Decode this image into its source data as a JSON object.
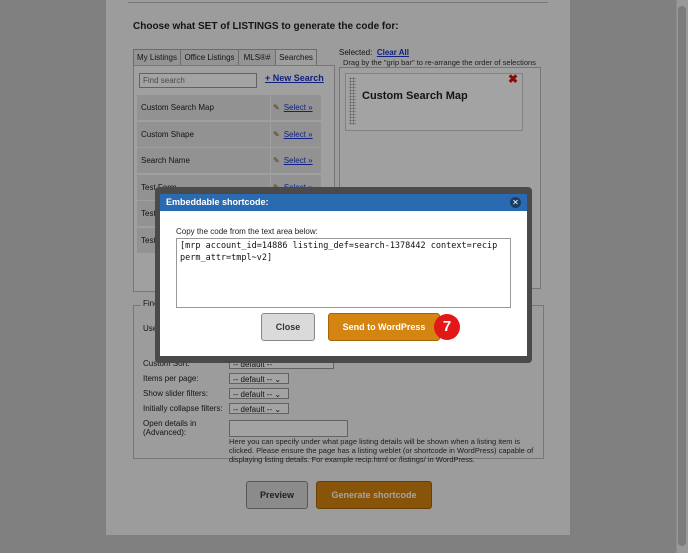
{
  "heading": "Choose what SET of LISTINGS to generate the code for:",
  "tabs": [
    {
      "label": "My Listings",
      "active": false
    },
    {
      "label": "Office Listings",
      "active": false
    },
    {
      "label": "MLS®#",
      "active": false
    },
    {
      "label": "Searches",
      "active": true
    }
  ],
  "search": {
    "placeholder": "Find search",
    "new_search_label": "+ New Search"
  },
  "searches": [
    {
      "name": "Custom Search Map",
      "select_label": "Select »"
    },
    {
      "name": "Custom Shape",
      "select_label": "Select »"
    },
    {
      "name": "Search Name",
      "select_label": "Select »"
    },
    {
      "name": "Test Form",
      "select_label": "Select »"
    },
    {
      "name": "Test S",
      "select_label": ""
    },
    {
      "name": "Test S",
      "select_label": ""
    }
  ],
  "selected": {
    "label": "Selected:",
    "clear_all": "Clear All",
    "hint": "Drag by the \"grip bar\" to re-arrange the order of selections",
    "items": [
      {
        "name": "Custom Search Map"
      }
    ]
  },
  "fine_tune": {
    "legend": "Fine",
    "use_label": "Use",
    "fields": [
      {
        "label": "Custom Sort:",
        "value": "-- default --"
      },
      {
        "label": "Items per page:",
        "value": "-- default --"
      },
      {
        "label": "Show slider filters:",
        "value": "-- default --"
      },
      {
        "label": "Initially collapse filters:",
        "value": "-- default --"
      }
    ],
    "open_details_label": "Open details in (Advanced):",
    "open_details_value": "",
    "help_text": "Here you can specify under what page listing details will be shown when a listing item is clicked. Please ensure the page has a listing weblet (or shortcode in WordPress) capable of displaying listing details. For example recip.html or /listings/ in WordPress."
  },
  "buttons": {
    "preview": "Preview",
    "generate": "Generate shortcode"
  },
  "dialog": {
    "title": "Embeddable shortcode:",
    "instruction": "Copy the code from the text area below:",
    "code": "[mrp account_id=14886 listing_def=search-1378442 context=recip perm_attr=tmpl~v2]",
    "close_label": "Close",
    "send_label": "Send to WordPress"
  },
  "step_badge": "7",
  "colors": {
    "accent_blue": "#2a6ab0",
    "orange": "#d48410",
    "badge_red": "#e21818"
  },
  "icons": {
    "edit": "pencil-icon",
    "remove": "close-x-icon",
    "dialog_close": "close-circle-icon"
  }
}
